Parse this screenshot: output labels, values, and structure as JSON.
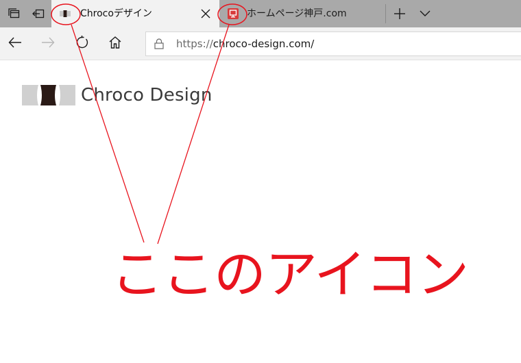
{
  "browser": {
    "tabs": [
      {
        "title": "Chrocoデザイン",
        "favicon": "chroco-logo-icon",
        "active": true
      },
      {
        "title": "ホームページ神戸.com",
        "favicon": "monitor-icon",
        "active": false
      }
    ],
    "address_bar": {
      "scheme": "https://",
      "host_path": "chroco-design.com/"
    }
  },
  "page": {
    "logo_text": "Chroco Design"
  },
  "annotation": {
    "label": "ここのアイコン",
    "color": "#e8141e"
  },
  "colors": {
    "tab_strip": "#a9a9a9",
    "active_tab": "#f2f2f2",
    "favicon_red": "#d83b3b"
  }
}
